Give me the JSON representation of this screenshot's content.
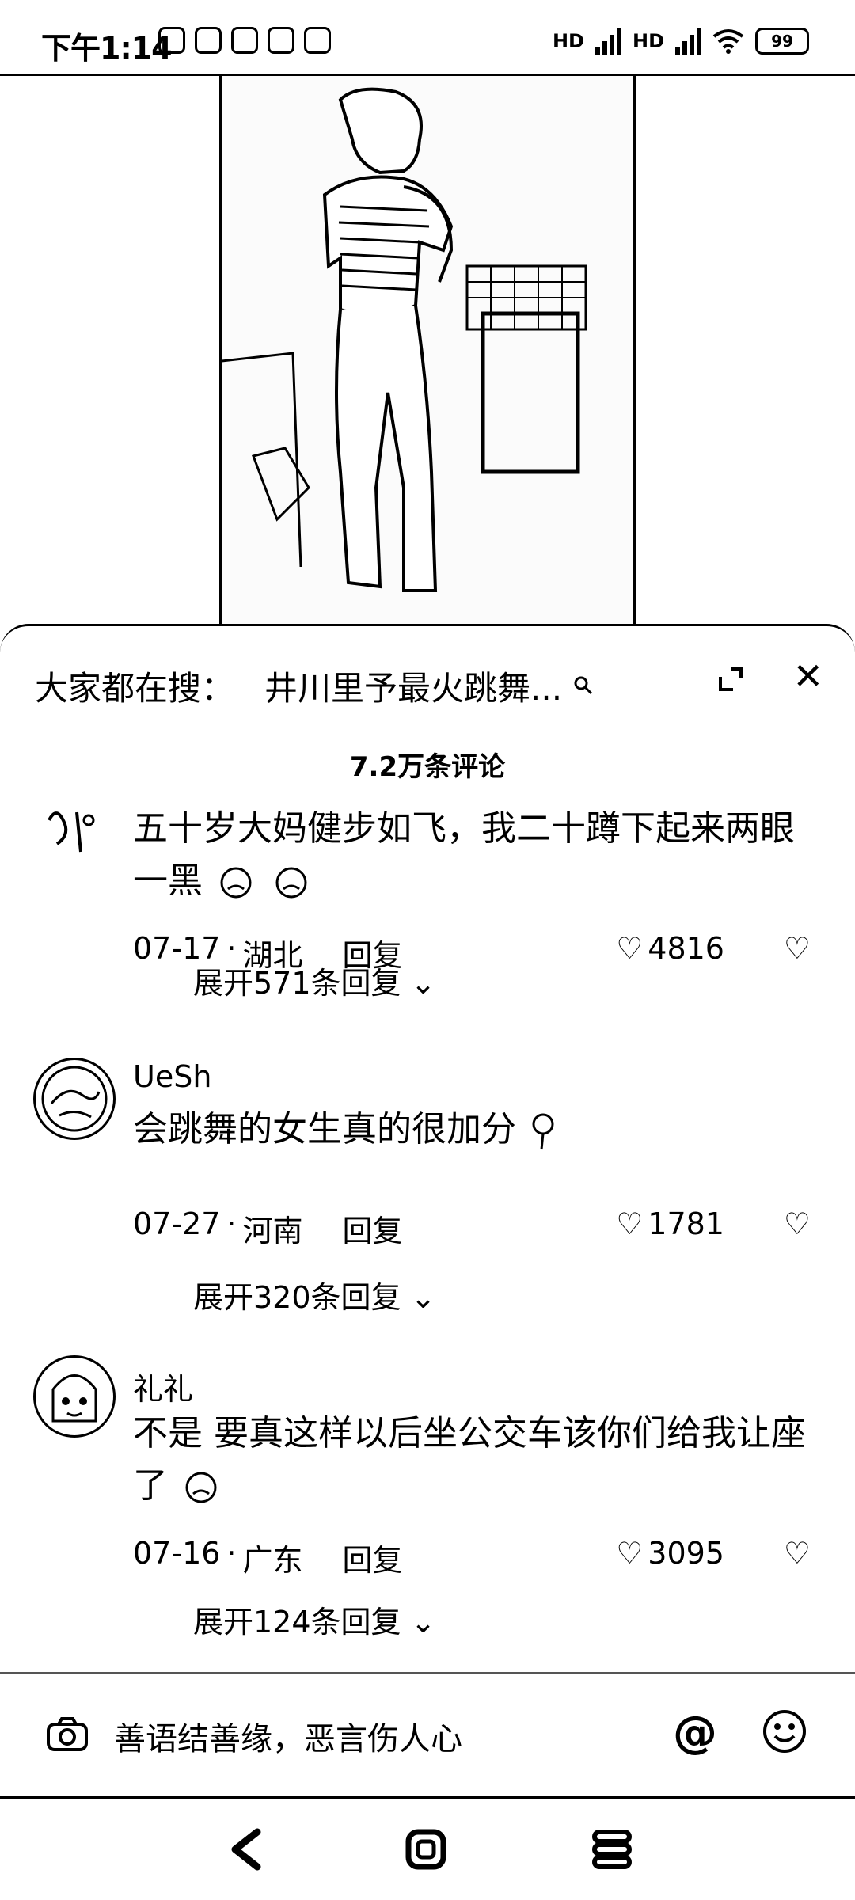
{
  "status_bar": {
    "time": "下午1:14",
    "network1": "HD",
    "network2": "HD",
    "battery": "99"
  },
  "search": {
    "prefix": "大家都在搜：",
    "term": "井川里予最火跳舞..."
  },
  "comments_header": {
    "count": "7.2万条评论"
  },
  "comments": [
    {
      "username": "",
      "content": "五十岁大妈健步如飞，我二十蹲下起来两眼一黑",
      "date": "07-17",
      "location": "湖北",
      "reply_label": "回复",
      "likes": "4816",
      "expand_label": "展开571条回复"
    },
    {
      "username": "UeSh",
      "content": "会跳舞的女生真的很加分",
      "date": "07-27",
      "location": "河南",
      "reply_label": "回复",
      "likes": "1781",
      "expand_label": "展开320条回复"
    },
    {
      "username": "礼礼",
      "content": "不是 要真这样以后坐公交车该你们给我让座了",
      "date": "07-16",
      "location": "广东",
      "reply_label": "回复",
      "likes": "3095",
      "expand_label": "展开124条回复"
    }
  ],
  "input": {
    "placeholder": "善语结善缘，恶言伤人心"
  },
  "icons": {
    "search": "search-icon",
    "expand": "expand-icon",
    "close": "close-icon",
    "camera": "camera-icon",
    "mention": "at-icon",
    "emoji": "emoji-icon",
    "like": "heart-icon",
    "dislike": "broken-heart-icon"
  }
}
